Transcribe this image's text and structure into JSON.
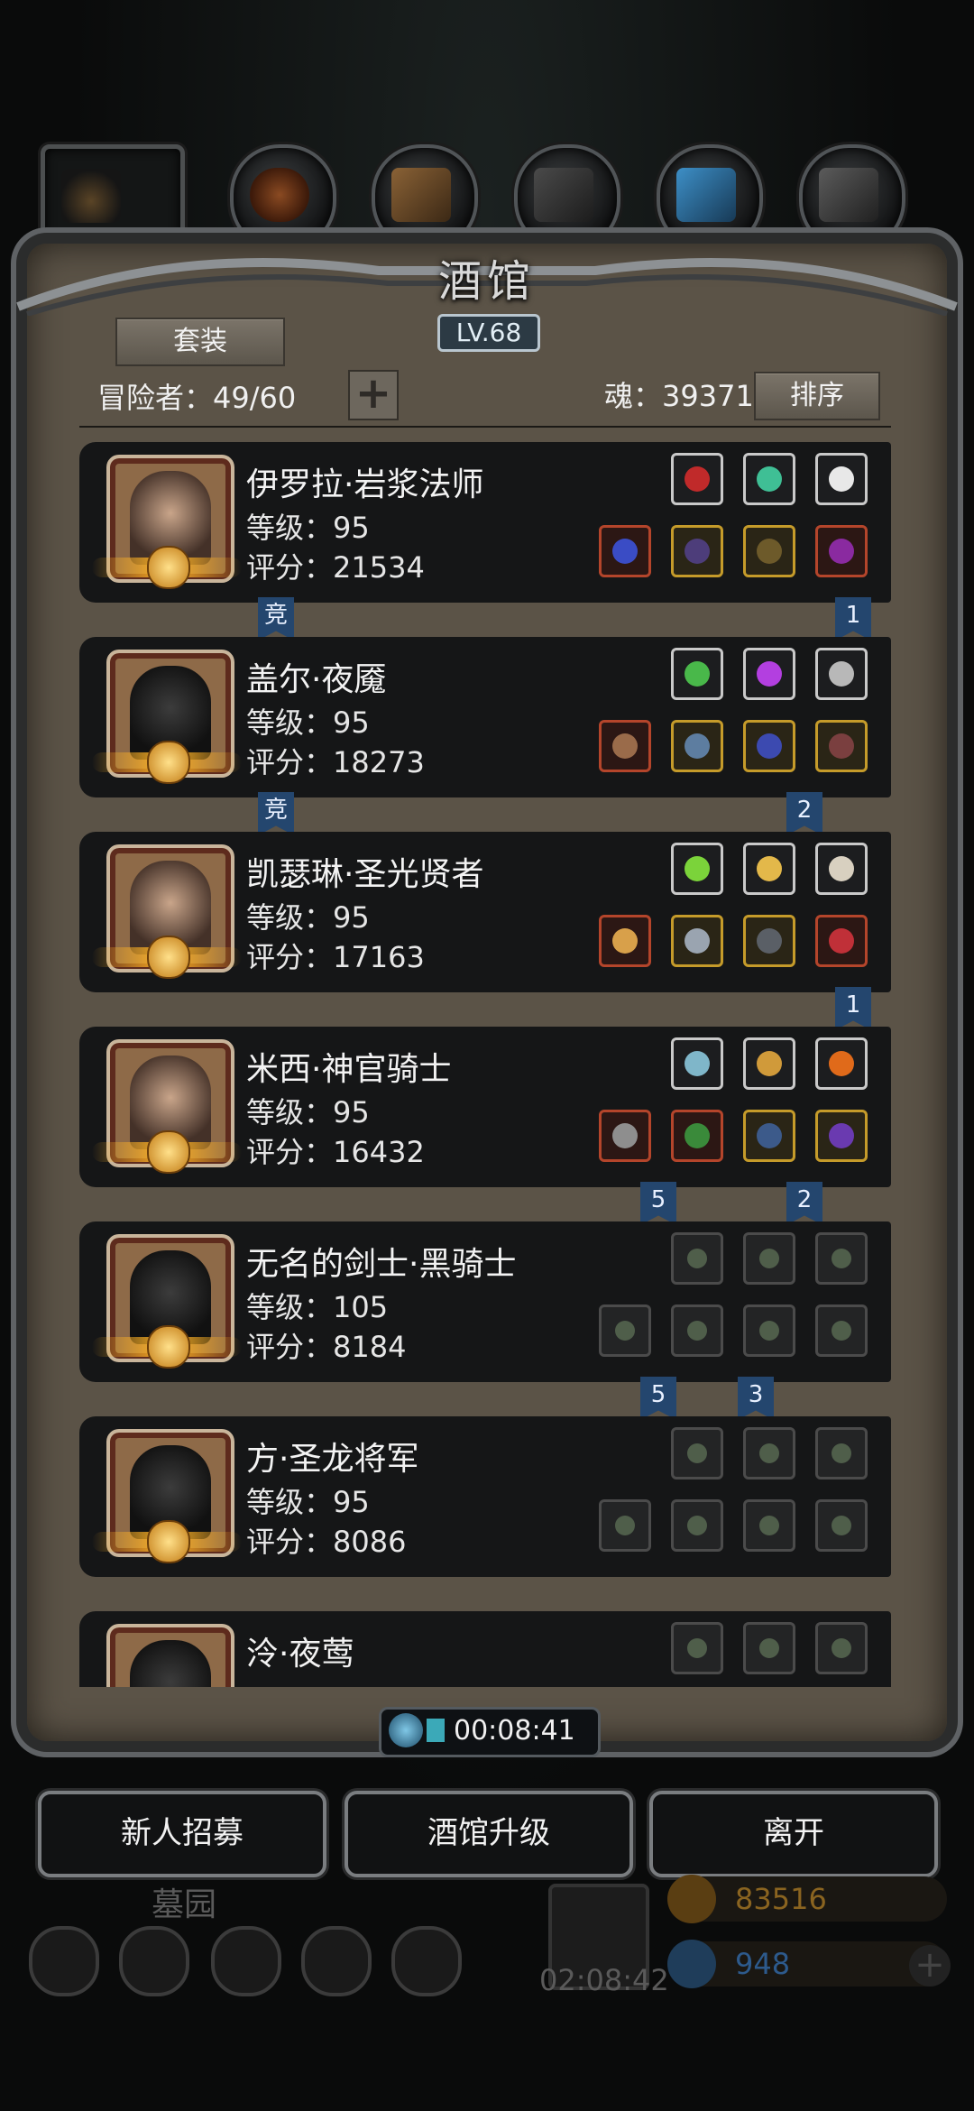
{
  "title": "酒馆",
  "level_badge": "LV.68",
  "buttons": {
    "outfit": "套装",
    "sort": "排序",
    "add_capacity": "+"
  },
  "adventurer_label": "冒险者：49/60",
  "soul_label": "魂：39371",
  "heroes": [
    {
      "name": "伊罗拉·岩浆法师",
      "level": "等级：95",
      "score": "评分：21534"
    },
    {
      "name": "盖尔·夜魇",
      "level": "等级：95",
      "score": "评分：18273"
    },
    {
      "name": "凯瑟琳·圣光贤者",
      "level": "等级：95",
      "score": "评分：17163"
    },
    {
      "name": "米西·神官骑士",
      "level": "等级：95",
      "score": "评分：16432"
    },
    {
      "name": "无名的剑士·黑骑士",
      "level": "等级：105",
      "score": "评分：8184"
    },
    {
      "name": "方·圣龙将军",
      "level": "等级：95",
      "score": "评分：8086"
    },
    {
      "name": "泠·夜莺",
      "level": "",
      "score": ""
    }
  ],
  "ribbons": {
    "r1a": "竞",
    "r1b": "1",
    "r2a": "竞",
    "r2b": "2",
    "r3a": "1",
    "r4a": "5",
    "r4b": "2",
    "r5a": "5",
    "r5b": "3"
  },
  "timer": "00:08:41",
  "actions": {
    "recruit": "新人招募",
    "upgrade": "酒馆升级",
    "leave": "离开"
  },
  "background": {
    "graveyard": "墓园",
    "timer2": "02:08:42",
    "gold": "83516",
    "gems": "948"
  },
  "colors": {
    "gold_text": "#a2701c",
    "gem_text": "#2d5a8c"
  }
}
